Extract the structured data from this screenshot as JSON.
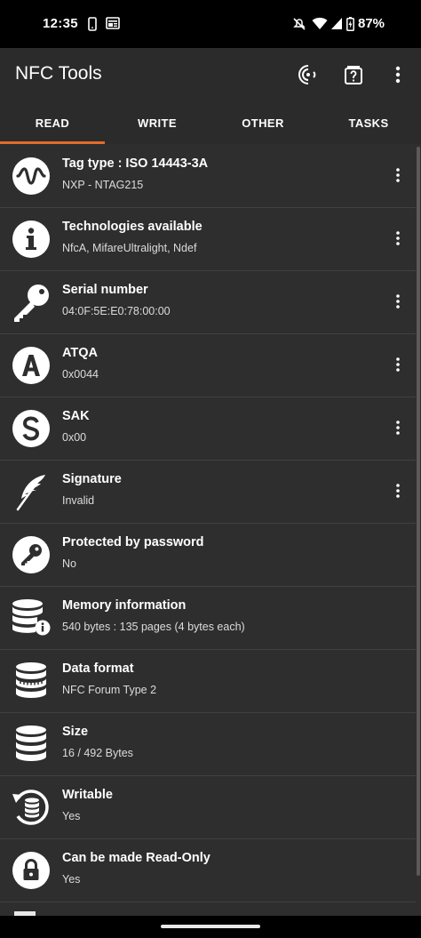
{
  "status_bar": {
    "time": "12:35",
    "battery": "87%",
    "icons": [
      "phone-icon",
      "news-icon",
      "mute-icon",
      "wifi-icon",
      "signal-icon",
      "battery-icon"
    ]
  },
  "app_bar": {
    "title": "NFC Tools",
    "actions": [
      "contactless-icon",
      "help-icon",
      "overflow-menu-icon"
    ]
  },
  "tabs": [
    {
      "label": "READ",
      "active": true
    },
    {
      "label": "WRITE",
      "active": false
    },
    {
      "label": "OTHER",
      "active": false
    },
    {
      "label": "TASKS",
      "active": false
    }
  ],
  "accent_color": "#e36c2a",
  "items": [
    {
      "icon": "nfc-wave-icon",
      "title": "Tag type : ISO 14443-3A",
      "subtitle": "NXP - NTAG215",
      "menu": true
    },
    {
      "icon": "info-icon",
      "title": "Technologies available",
      "subtitle": "NfcA, MifareUltralight, Ndef",
      "menu": true
    },
    {
      "icon": "key-icon",
      "title": "Serial number",
      "subtitle": "04:0F:5E:E0:78:00:00",
      "menu": true
    },
    {
      "icon": "letter-a-icon",
      "title": "ATQA",
      "subtitle": "0x0044",
      "menu": true
    },
    {
      "icon": "letter-s-icon",
      "title": "SAK",
      "subtitle": "0x00",
      "menu": true
    },
    {
      "icon": "feather-icon",
      "title": "Signature",
      "subtitle": "Invalid",
      "menu": true
    },
    {
      "icon": "password-key-icon",
      "title": "Protected by password",
      "subtitle": "No",
      "menu": false
    },
    {
      "icon": "database-info-icon",
      "title": "Memory information",
      "subtitle": "540 bytes : 135 pages (4 bytes each)",
      "menu": false
    },
    {
      "icon": "database-format-icon",
      "title": "Data format",
      "subtitle": "NFC Forum Type 2",
      "menu": false
    },
    {
      "icon": "database-icon",
      "title": "Size",
      "subtitle": "16 / 492 Bytes",
      "menu": false
    },
    {
      "icon": "database-refresh-icon",
      "title": "Writable",
      "subtitle": "Yes",
      "menu": false
    },
    {
      "icon": "lock-icon",
      "title": "Can be made Read-Only",
      "subtitle": "Yes",
      "menu": false
    }
  ]
}
